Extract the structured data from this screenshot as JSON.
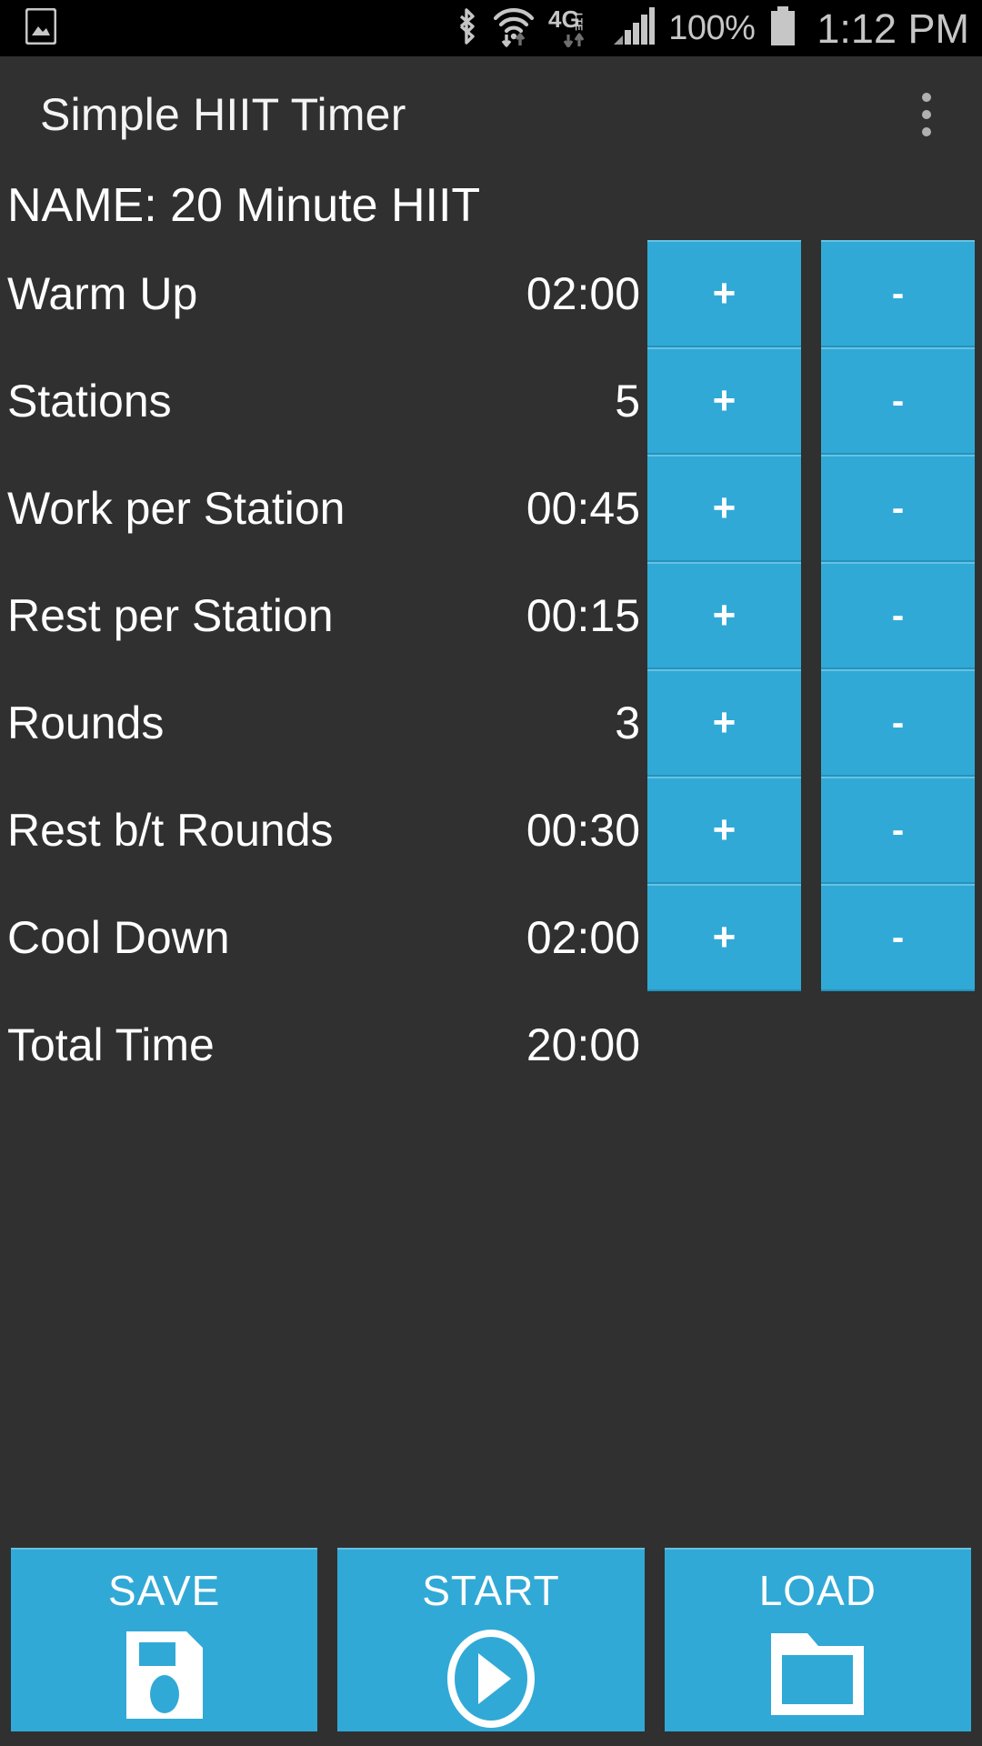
{
  "statusbar": {
    "time": "1:12 PM",
    "battery_percent": "100%",
    "icons": [
      "photo-icon",
      "bluetooth-icon",
      "wifi-icon",
      "4glte-icon",
      "signal-bars-icon",
      "battery-icon"
    ]
  },
  "actionbar": {
    "title": "Simple HIIT Timer",
    "overflow_label": "overflow-menu"
  },
  "workout": {
    "name_line": "NAME: 20 Minute HIIT",
    "plus_label": "+",
    "minus_label": "-",
    "rows": [
      {
        "label": "Warm Up",
        "value": "02:00",
        "has_buttons": true
      },
      {
        "label": "Stations",
        "value": "5",
        "has_buttons": true
      },
      {
        "label": "Work per Station",
        "value": "00:45",
        "has_buttons": true
      },
      {
        "label": "Rest per Station",
        "value": "00:15",
        "has_buttons": true
      },
      {
        "label": "Rounds",
        "value": "3",
        "has_buttons": true
      },
      {
        "label": "Rest b/t Rounds",
        "value": "00:30",
        "has_buttons": true
      },
      {
        "label": "Cool Down",
        "value": "02:00",
        "has_buttons": true
      },
      {
        "label": "Total Time",
        "value": "20:00",
        "has_buttons": false
      }
    ]
  },
  "bottombar": {
    "buttons": [
      {
        "label": "SAVE",
        "icon": "floppy-disk-icon"
      },
      {
        "label": "START",
        "icon": "play-circle-icon"
      },
      {
        "label": "LOAD",
        "icon": "folder-icon"
      }
    ]
  },
  "colors": {
    "accent": "#31a9d6",
    "background": "#303030",
    "statusbar": "#000000",
    "text": "#ffffff",
    "statusbar_text": "#c6c6c6"
  }
}
